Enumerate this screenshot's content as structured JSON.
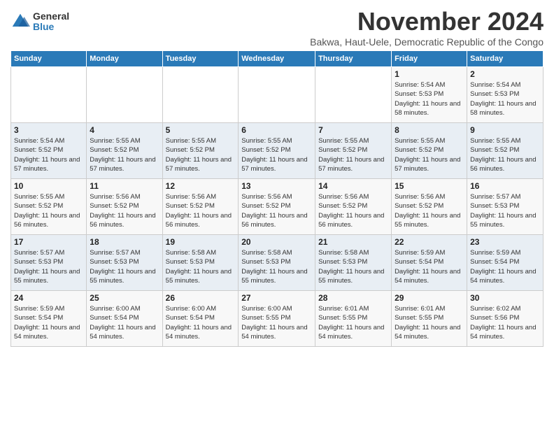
{
  "logo": {
    "general": "General",
    "blue": "Blue"
  },
  "title": "November 2024",
  "subtitle": "Bakwa, Haut-Uele, Democratic Republic of the Congo",
  "weekdays": [
    "Sunday",
    "Monday",
    "Tuesday",
    "Wednesday",
    "Thursday",
    "Friday",
    "Saturday"
  ],
  "weeks": [
    [
      {
        "day": "",
        "info": ""
      },
      {
        "day": "",
        "info": ""
      },
      {
        "day": "",
        "info": ""
      },
      {
        "day": "",
        "info": ""
      },
      {
        "day": "",
        "info": ""
      },
      {
        "day": "1",
        "info": "Sunrise: 5:54 AM\nSunset: 5:53 PM\nDaylight: 11 hours and 58 minutes."
      },
      {
        "day": "2",
        "info": "Sunrise: 5:54 AM\nSunset: 5:53 PM\nDaylight: 11 hours and 58 minutes."
      }
    ],
    [
      {
        "day": "3",
        "info": "Sunrise: 5:54 AM\nSunset: 5:52 PM\nDaylight: 11 hours and 57 minutes."
      },
      {
        "day": "4",
        "info": "Sunrise: 5:55 AM\nSunset: 5:52 PM\nDaylight: 11 hours and 57 minutes."
      },
      {
        "day": "5",
        "info": "Sunrise: 5:55 AM\nSunset: 5:52 PM\nDaylight: 11 hours and 57 minutes."
      },
      {
        "day": "6",
        "info": "Sunrise: 5:55 AM\nSunset: 5:52 PM\nDaylight: 11 hours and 57 minutes."
      },
      {
        "day": "7",
        "info": "Sunrise: 5:55 AM\nSunset: 5:52 PM\nDaylight: 11 hours and 57 minutes."
      },
      {
        "day": "8",
        "info": "Sunrise: 5:55 AM\nSunset: 5:52 PM\nDaylight: 11 hours and 57 minutes."
      },
      {
        "day": "9",
        "info": "Sunrise: 5:55 AM\nSunset: 5:52 PM\nDaylight: 11 hours and 56 minutes."
      }
    ],
    [
      {
        "day": "10",
        "info": "Sunrise: 5:55 AM\nSunset: 5:52 PM\nDaylight: 11 hours and 56 minutes."
      },
      {
        "day": "11",
        "info": "Sunrise: 5:56 AM\nSunset: 5:52 PM\nDaylight: 11 hours and 56 minutes."
      },
      {
        "day": "12",
        "info": "Sunrise: 5:56 AM\nSunset: 5:52 PM\nDaylight: 11 hours and 56 minutes."
      },
      {
        "day": "13",
        "info": "Sunrise: 5:56 AM\nSunset: 5:52 PM\nDaylight: 11 hours and 56 minutes."
      },
      {
        "day": "14",
        "info": "Sunrise: 5:56 AM\nSunset: 5:52 PM\nDaylight: 11 hours and 56 minutes."
      },
      {
        "day": "15",
        "info": "Sunrise: 5:56 AM\nSunset: 5:52 PM\nDaylight: 11 hours and 55 minutes."
      },
      {
        "day": "16",
        "info": "Sunrise: 5:57 AM\nSunset: 5:53 PM\nDaylight: 11 hours and 55 minutes."
      }
    ],
    [
      {
        "day": "17",
        "info": "Sunrise: 5:57 AM\nSunset: 5:53 PM\nDaylight: 11 hours and 55 minutes."
      },
      {
        "day": "18",
        "info": "Sunrise: 5:57 AM\nSunset: 5:53 PM\nDaylight: 11 hours and 55 minutes."
      },
      {
        "day": "19",
        "info": "Sunrise: 5:58 AM\nSunset: 5:53 PM\nDaylight: 11 hours and 55 minutes."
      },
      {
        "day": "20",
        "info": "Sunrise: 5:58 AM\nSunset: 5:53 PM\nDaylight: 11 hours and 55 minutes."
      },
      {
        "day": "21",
        "info": "Sunrise: 5:58 AM\nSunset: 5:53 PM\nDaylight: 11 hours and 55 minutes."
      },
      {
        "day": "22",
        "info": "Sunrise: 5:59 AM\nSunset: 5:54 PM\nDaylight: 11 hours and 54 minutes."
      },
      {
        "day": "23",
        "info": "Sunrise: 5:59 AM\nSunset: 5:54 PM\nDaylight: 11 hours and 54 minutes."
      }
    ],
    [
      {
        "day": "24",
        "info": "Sunrise: 5:59 AM\nSunset: 5:54 PM\nDaylight: 11 hours and 54 minutes."
      },
      {
        "day": "25",
        "info": "Sunrise: 6:00 AM\nSunset: 5:54 PM\nDaylight: 11 hours and 54 minutes."
      },
      {
        "day": "26",
        "info": "Sunrise: 6:00 AM\nSunset: 5:54 PM\nDaylight: 11 hours and 54 minutes."
      },
      {
        "day": "27",
        "info": "Sunrise: 6:00 AM\nSunset: 5:55 PM\nDaylight: 11 hours and 54 minutes."
      },
      {
        "day": "28",
        "info": "Sunrise: 6:01 AM\nSunset: 5:55 PM\nDaylight: 11 hours and 54 minutes."
      },
      {
        "day": "29",
        "info": "Sunrise: 6:01 AM\nSunset: 5:55 PM\nDaylight: 11 hours and 54 minutes."
      },
      {
        "day": "30",
        "info": "Sunrise: 6:02 AM\nSunset: 5:56 PM\nDaylight: 11 hours and 54 minutes."
      }
    ]
  ]
}
